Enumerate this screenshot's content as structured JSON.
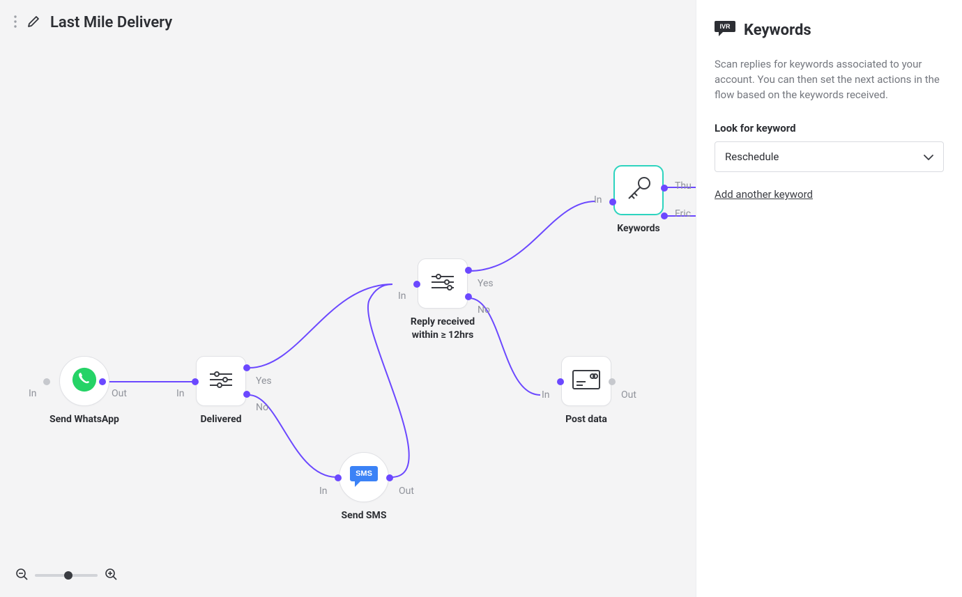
{
  "header": {
    "title": "Last Mile Delivery"
  },
  "nodes": {
    "whatsapp": {
      "label": "Send WhatsApp",
      "in": "In",
      "out": "Out"
    },
    "delivered": {
      "label": "Delivered",
      "in": "In",
      "yes": "Yes",
      "no": "No"
    },
    "reply": {
      "label": "Reply received\nwithin ≥ 12hrs",
      "in": "In",
      "yes": "Yes",
      "no": "No"
    },
    "sms": {
      "label": "Send SMS",
      "in": "In",
      "out": "Out"
    },
    "post": {
      "label": "Post data",
      "in": "In",
      "out": "Out"
    },
    "keywords": {
      "label": "Keywords",
      "in": "In",
      "out1": "Thu",
      "out2": "Fric"
    }
  },
  "panel": {
    "badge": "IVR",
    "title": "Keywords",
    "description": "Scan replies for keywords associated to your account. You can then set the next actions in the flow based on the keywords received.",
    "field_label": "Look for keyword",
    "selected": "Reschedule",
    "add_link": "Add another keyword"
  }
}
